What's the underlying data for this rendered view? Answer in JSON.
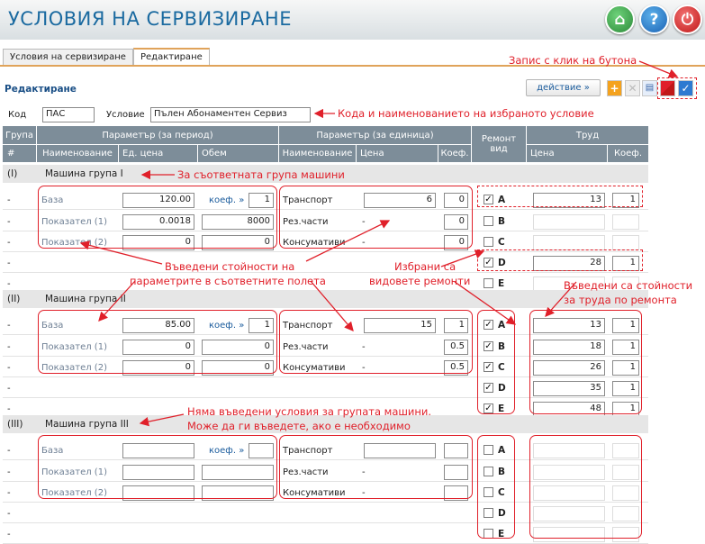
{
  "app": {
    "title": "УСЛОВИЯ НА СЕРВИЗИРАНЕ",
    "icons": [
      "home-icon",
      "help-icon",
      "power-icon"
    ]
  },
  "tabs": [
    {
      "label": "Условия на сервизиране"
    },
    {
      "label": "Редактиране"
    }
  ],
  "section": {
    "title": "Редактиране"
  },
  "toolbar": {
    "action_label": "действие »",
    "icons": [
      "add-icon",
      "delete-icon",
      "list-icon",
      "cancel-icon",
      "save-icon"
    ]
  },
  "form": {
    "code_label": "Код",
    "code_value": "ПАС",
    "cond_label": "Условие",
    "cond_value": "Пълен Абонаментен Сервиз"
  },
  "header": {
    "group": "Група",
    "group_num": "#",
    "param_period": "Параметър (за период)",
    "name": "Наименование",
    "unit_price": "Ед. цена",
    "volume": "Обем",
    "param_unit": "Параметър (за единица)",
    "name2": "Наименование",
    "price": "Цена",
    "coef": "Коеф.",
    "repair": "Ремонт вид",
    "labor": "Труд",
    "labor_price": "Цена",
    "labor_coef": "Коеф."
  },
  "dash": "-",
  "coef_label": "коеф. »",
  "groups": [
    {
      "num": "(I)",
      "name": "Машина група I",
      "period": [
        {
          "name": "База",
          "price": "120.00",
          "coef": "1"
        },
        {
          "name": "Показател (1)",
          "price": "0.0018",
          "volume": "8000"
        },
        {
          "name": "Показател (2)",
          "price": "0",
          "volume": "0"
        }
      ],
      "unit": [
        {
          "name": "Транспорт",
          "price": "6",
          "coef": "0"
        },
        {
          "name": "Рез.части",
          "price": "-",
          "coef": "0"
        },
        {
          "name": "Консумативи",
          "price": "-",
          "coef": "0"
        }
      ],
      "repairs": [
        {
          "type": "A",
          "checked": true,
          "price": "13",
          "coef": "1"
        },
        {
          "type": "B",
          "checked": false,
          "price": "",
          "coef": ""
        },
        {
          "type": "C",
          "checked": false,
          "price": "",
          "coef": ""
        },
        {
          "type": "D",
          "checked": true,
          "price": "28",
          "coef": "1"
        },
        {
          "type": "E",
          "checked": false,
          "price": "",
          "coef": ""
        }
      ]
    },
    {
      "num": "(II)",
      "name": "Машина група II",
      "period": [
        {
          "name": "База",
          "price": "85.00",
          "coef": "1"
        },
        {
          "name": "Показател (1)",
          "price": "0",
          "volume": "0"
        },
        {
          "name": "Показател (2)",
          "price": "0",
          "volume": "0"
        }
      ],
      "unit": [
        {
          "name": "Транспорт",
          "price": "15",
          "coef": "1"
        },
        {
          "name": "Рез.части",
          "price": "-",
          "coef": "0.5"
        },
        {
          "name": "Консумативи",
          "price": "-",
          "coef": "0.5"
        }
      ],
      "repairs": [
        {
          "type": "A",
          "checked": true,
          "price": "13",
          "coef": "1"
        },
        {
          "type": "B",
          "checked": true,
          "price": "18",
          "coef": "1"
        },
        {
          "type": "C",
          "checked": true,
          "price": "26",
          "coef": "1"
        },
        {
          "type": "D",
          "checked": true,
          "price": "35",
          "coef": "1"
        },
        {
          "type": "E",
          "checked": true,
          "price": "48",
          "coef": "1"
        }
      ]
    },
    {
      "num": "(III)",
      "name": "Машина група III",
      "period": [
        {
          "name": "База",
          "price": "",
          "coef": ""
        },
        {
          "name": "Показател (1)",
          "price": "",
          "volume": ""
        },
        {
          "name": "Показател (2)",
          "price": "",
          "volume": ""
        }
      ],
      "unit": [
        {
          "name": "Транспорт",
          "price": "",
          "coef": ""
        },
        {
          "name": "Рез.части",
          "price": "-",
          "coef": ""
        },
        {
          "name": "Консумативи",
          "price": "-",
          "coef": ""
        }
      ],
      "repairs": [
        {
          "type": "A",
          "checked": false
        },
        {
          "type": "B",
          "checked": false
        },
        {
          "type": "C",
          "checked": false
        },
        {
          "type": "D",
          "checked": false
        },
        {
          "type": "E",
          "checked": false
        }
      ]
    }
  ],
  "annotations": {
    "save": "Запис с клик на бутона",
    "code": "Кода и наименованието на избраното условие",
    "group": "За съответната група машини",
    "values_1": "Въведени стойности на",
    "values_2": "параметрите в съответните полета",
    "selected_1": "Избрани са",
    "selected_2": "видовете ремонти",
    "labor_1": "Въведени са стойности",
    "labor_2": "за труда по ремонта",
    "none_1": "Няма въведени условия за  групата машини.",
    "none_2": "Може да ги въведете, ако е необходимо"
  },
  "colors": {
    "title": "#1a6aa0",
    "header_bg": "#7d8d99",
    "annotation": "#e0202a",
    "tab_accent": "#e0a35a"
  }
}
